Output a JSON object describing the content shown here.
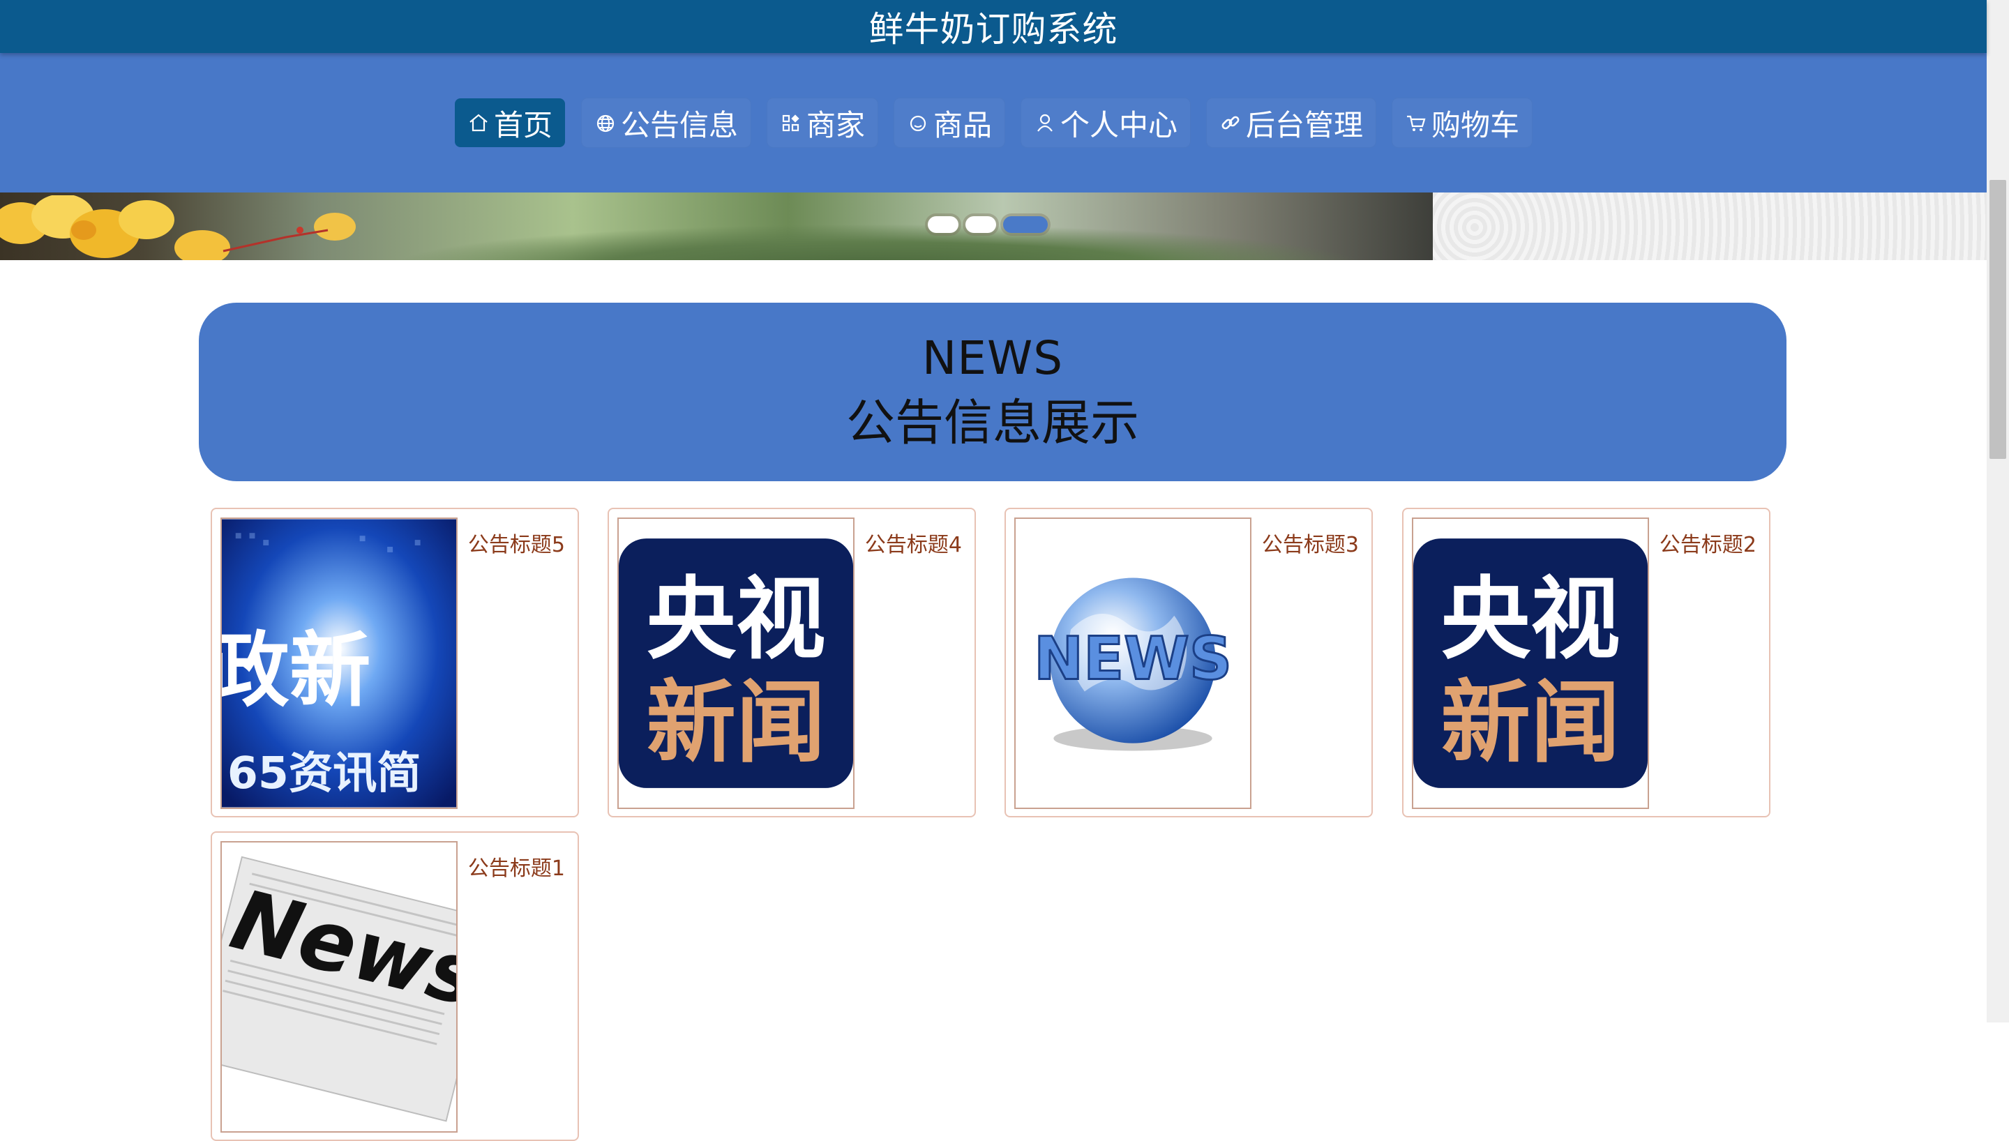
{
  "app": {
    "title": "鲜牛奶订购系统"
  },
  "nav": {
    "items": [
      {
        "label": "首页",
        "icon": "home-icon",
        "active": true
      },
      {
        "label": "公告信息",
        "icon": "globe-icon"
      },
      {
        "label": "商家",
        "icon": "grid-icon"
      },
      {
        "label": "商品",
        "icon": "circle-icon"
      },
      {
        "label": "个人中心",
        "icon": "user-icon"
      },
      {
        "label": "后台管理",
        "icon": "link-icon"
      },
      {
        "label": "购物车",
        "icon": "cart-icon"
      }
    ]
  },
  "carousel": {
    "active_index": 2,
    "count": 3
  },
  "news": {
    "heading_en": "NEWS",
    "heading_cn": "公告信息展示",
    "cards": [
      {
        "title": "公告标题5",
        "image_text_1": "政新",
        "image_text_2": "65资讯简"
      },
      {
        "title": "公告标题4",
        "image_text_1": "央视",
        "image_text_2": "新闻"
      },
      {
        "title": "公告标题3",
        "image_text_1": "NEWS"
      },
      {
        "title": "公告标题2",
        "image_text_1": "央视",
        "image_text_2": "新闻"
      },
      {
        "title": "公告标题1",
        "image_text_1": "News"
      }
    ]
  },
  "colors": {
    "topbar": "#0b5a8e",
    "nav_bg": "#4878c8",
    "accent": "#8b3a1a",
    "cctv_navy": "#0b1f5c",
    "cctv_orange": "#e0a270"
  }
}
